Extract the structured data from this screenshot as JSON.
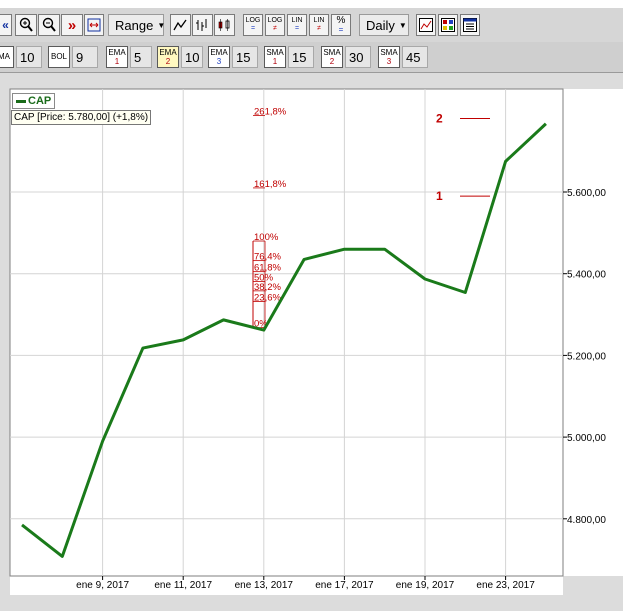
{
  "toolbar": {
    "range_label": "Range",
    "period_label": "Daily",
    "log_label": "LOG",
    "lin_label": "LIN",
    "percent_label": "%"
  },
  "indicators": [
    {
      "name": "MA",
      "value": "10"
    },
    {
      "name": "BOL",
      "value": "9"
    },
    {
      "name": "EMA",
      "sub": "1",
      "value": "5"
    },
    {
      "name": "EMA",
      "sub": "2",
      "value": "10"
    },
    {
      "name": "EMA",
      "sub": "3",
      "value": "15"
    },
    {
      "name": "SMA",
      "sub": "1",
      "value": "15"
    },
    {
      "name": "SMA",
      "sub": "2",
      "value": "30"
    },
    {
      "name": "SMA",
      "sub": "3",
      "value": "45"
    }
  ],
  "legend": {
    "series": "CAP"
  },
  "price_label": "CAP [Price: 5.780,00] (+1,8%)",
  "colors": {
    "series": "#1a7a1a",
    "fib": "#c00000",
    "grid": "#d4d4d4"
  },
  "chart_data": {
    "type": "line",
    "x": [
      "ene 6, 2017",
      "ene 9, 2017",
      "ene 10, 2017",
      "ene 11, 2017",
      "ene 12, 2017",
      "ene 13, 2017",
      "ene 16, 2017",
      "ene 17, 2017",
      "ene 18, 2017",
      "ene 19, 2017",
      "ene 20, 2017",
      "ene 23, 2017",
      "ene 24, 2017"
    ],
    "series": [
      {
        "name": "CAP",
        "values": [
          4785,
          4708,
          4990,
          5218,
          5238,
          5287,
          5262,
          5435,
          5460,
          5460,
          5387,
          5354,
          5675,
          5767
        ]
      }
    ],
    "x_index": [
      0,
      1,
      2,
      3,
      4,
      5,
      6,
      7,
      8,
      9,
      10,
      11,
      12,
      13
    ],
    "x_tick_labels": [
      "ene 9, 2017",
      "ene 11, 2017",
      "ene 13, 2017",
      "ene 17, 2017",
      "ene 19, 2017",
      "ene 23, 2017"
    ],
    "x_tick_index": [
      2,
      4,
      6,
      8,
      10,
      12
    ],
    "y_ticks": [
      4800,
      5000,
      5200,
      5400,
      5600
    ],
    "y_tick_labels": [
      "4.800,00",
      "5.000,00",
      "5.200,00",
      "5.400,00",
      "5.600,00"
    ],
    "ylim": [
      4700,
      5800
    ],
    "grid": true,
    "fibonacci": [
      {
        "label": "261,8%",
        "value": 5787
      },
      {
        "label": "161,8%",
        "value": 5610
      },
      {
        "label": "100%",
        "value": 5480
      },
      {
        "label": "76,4%",
        "value": 5432
      },
      {
        "label": "61,8%",
        "value": 5405
      },
      {
        "label": "50%",
        "value": 5381
      },
      {
        "label": "38,2%",
        "value": 5358
      },
      {
        "label": "23,6%",
        "value": 5332
      },
      {
        "label": "0%",
        "value": 5268
      }
    ],
    "annotations": [
      {
        "label": "1",
        "value": 5590
      },
      {
        "label": "2",
        "value": 5780
      }
    ]
  }
}
